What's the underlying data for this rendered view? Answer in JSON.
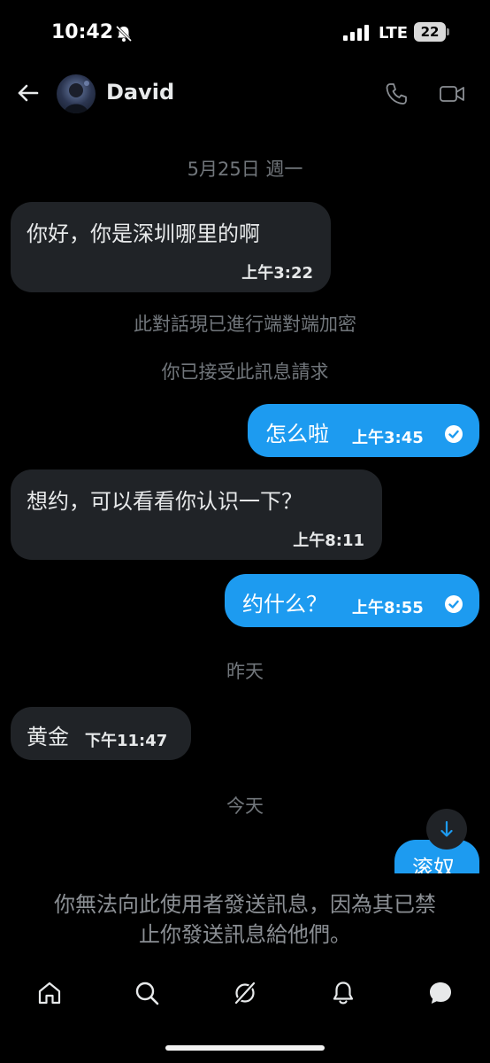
{
  "status_bar": {
    "time": "10:42",
    "network": "LTE",
    "battery": "22",
    "icons": [
      "bell-off-icon",
      "signal-icon"
    ]
  },
  "header": {
    "contact_name": "David",
    "icons": [
      "back-arrow-icon",
      "phone-icon",
      "video-camera-icon"
    ]
  },
  "conversation": {
    "date_separator_1": "5月25日 週一",
    "messages": [
      {
        "direction": "in",
        "text": "你好，你是深圳哪里的啊",
        "time": "上午3:22"
      },
      {
        "direction": "out",
        "text": "怎么啦",
        "time": "上午3:45",
        "status": "read"
      },
      {
        "direction": "in",
        "text": "想约，可以看看你认识一下？",
        "time": "上午8:11"
      },
      {
        "direction": "out",
        "text": "约什么？",
        "time": "上午8:55",
        "status": "read"
      },
      {
        "direction": "in",
        "text": "黄金",
        "time": "下午11:47"
      },
      {
        "direction": "out",
        "text": "滚奴",
        "time": ""
      }
    ],
    "system_notes": {
      "encryption": "此對話現已進行端對端加密",
      "accepted": "你已接受此訊息請求"
    },
    "date_separator_yesterday": "昨天",
    "date_separator_today": "今天"
  },
  "blocked_notice": {
    "line1": "你無法向此使用者發送訊息，因為其已禁",
    "line2": "止你發送訊息給他們。"
  },
  "bottom_nav": {
    "items": [
      "home-icon",
      "search-icon",
      "grok-icon",
      "notifications-icon",
      "messages-icon"
    ]
  },
  "colors": {
    "background": "#000000",
    "incoming_bubble": "#202327",
    "outgoing_bubble": "#1d9bf0",
    "secondary_text": "#71767b"
  }
}
